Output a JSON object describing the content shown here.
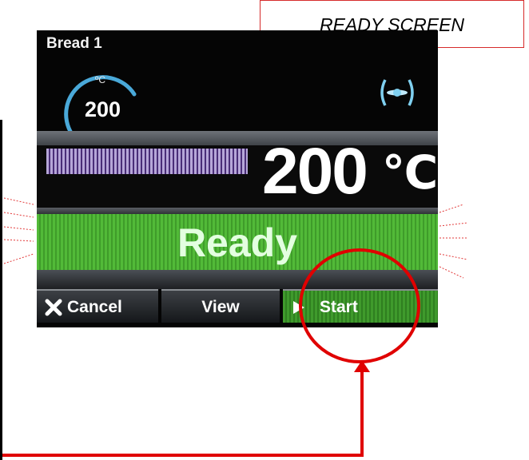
{
  "annotation": {
    "label": "READY SCREEN"
  },
  "screen": {
    "recipe_name": "Bread 1",
    "gauge": {
      "unit": "ºC",
      "value": "200"
    },
    "temperature": {
      "value": "200",
      "unit": "℃"
    },
    "status": "Ready",
    "buttons": {
      "cancel": "Cancel",
      "view": "View",
      "start": "Start"
    }
  },
  "icons": {
    "fan": "fan-icon",
    "cancel": "close-icon",
    "start": "play-icon"
  },
  "colors": {
    "ready_green": "#4fb534",
    "start_green": "#37892a",
    "annotation_red": "#e00000",
    "gauge_arc": "#4aa9d9"
  }
}
